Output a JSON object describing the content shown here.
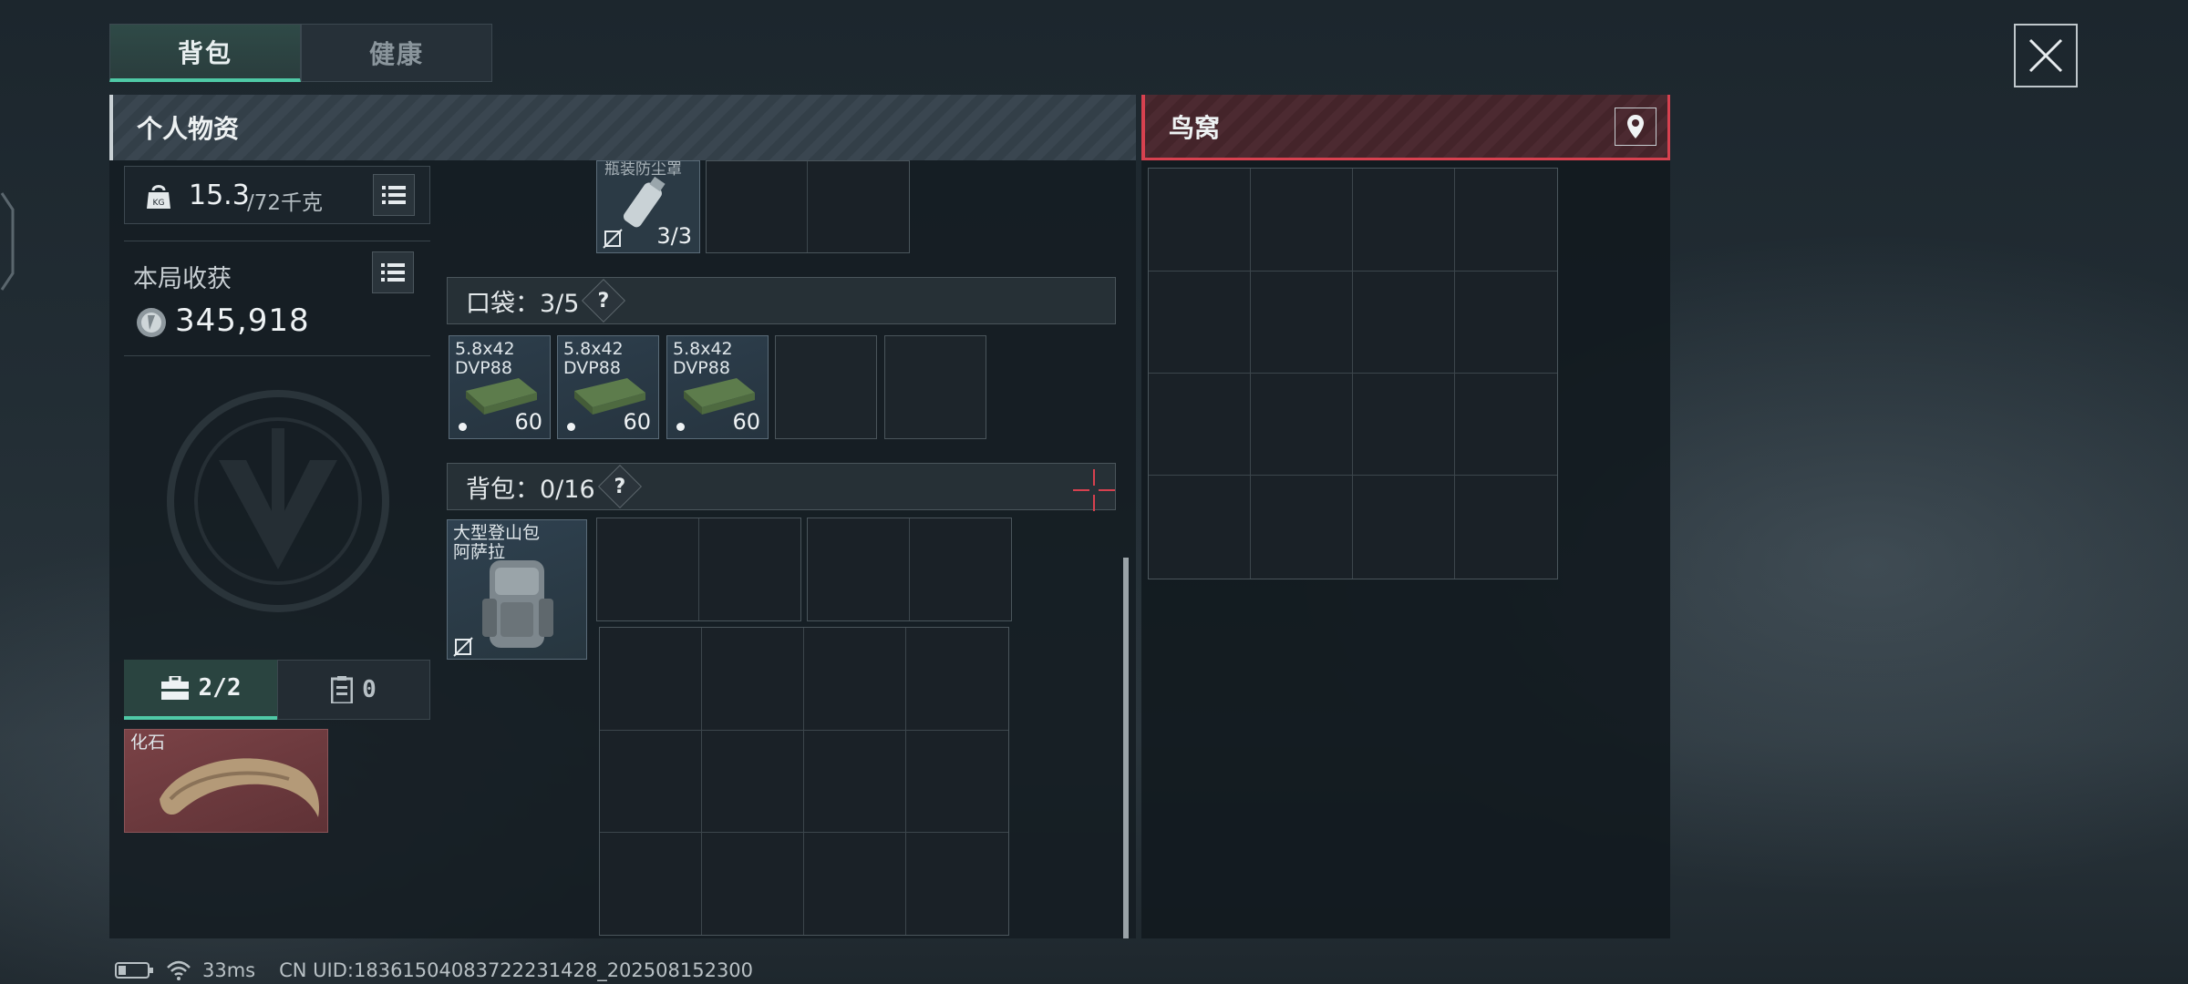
{
  "tabs": [
    {
      "label": "背包",
      "active": true
    },
    {
      "label": "健康",
      "active": false
    }
  ],
  "personal_panel": {
    "title": "个人物资",
    "weight_value": "15.3",
    "weight_max": "/72千克",
    "harvest_label": "本局收获",
    "harvest_value": "345,918",
    "mode_tabs": [
      {
        "icon": "toolbox-icon",
        "count": "2/2"
      },
      {
        "icon": "clipboard-icon",
        "count": "0"
      }
    ],
    "special_item": {
      "label": "化石"
    }
  },
  "containers": {
    "top_item": {
      "label": "瓶装防尘罩",
      "count": "3/3"
    },
    "pocket": {
      "label": "口袋：3/5",
      "items": [
        {
          "line1": "5.8x42",
          "line2": "DVP88",
          "count": "60"
        },
        {
          "line1": "5.8x42",
          "line2": "DVP88",
          "count": "60"
        },
        {
          "line1": "5.8x42",
          "line2": "DVP88",
          "count": "60"
        }
      ]
    },
    "backpack": {
      "label": "背包：0/16",
      "item": {
        "line1": "大型登山包",
        "line2": "阿萨拉"
      }
    }
  },
  "nest_panel": {
    "title": "鸟窝"
  },
  "help_symbol": "?",
  "status_bar": {
    "ping": "33ms",
    "uid": "CN UID:18361504083722231428_202508152300"
  },
  "colors": {
    "accent_green": "#4fc9a6",
    "nest_red": "#d7414f",
    "fossil_bg": "#6b3a3c"
  }
}
